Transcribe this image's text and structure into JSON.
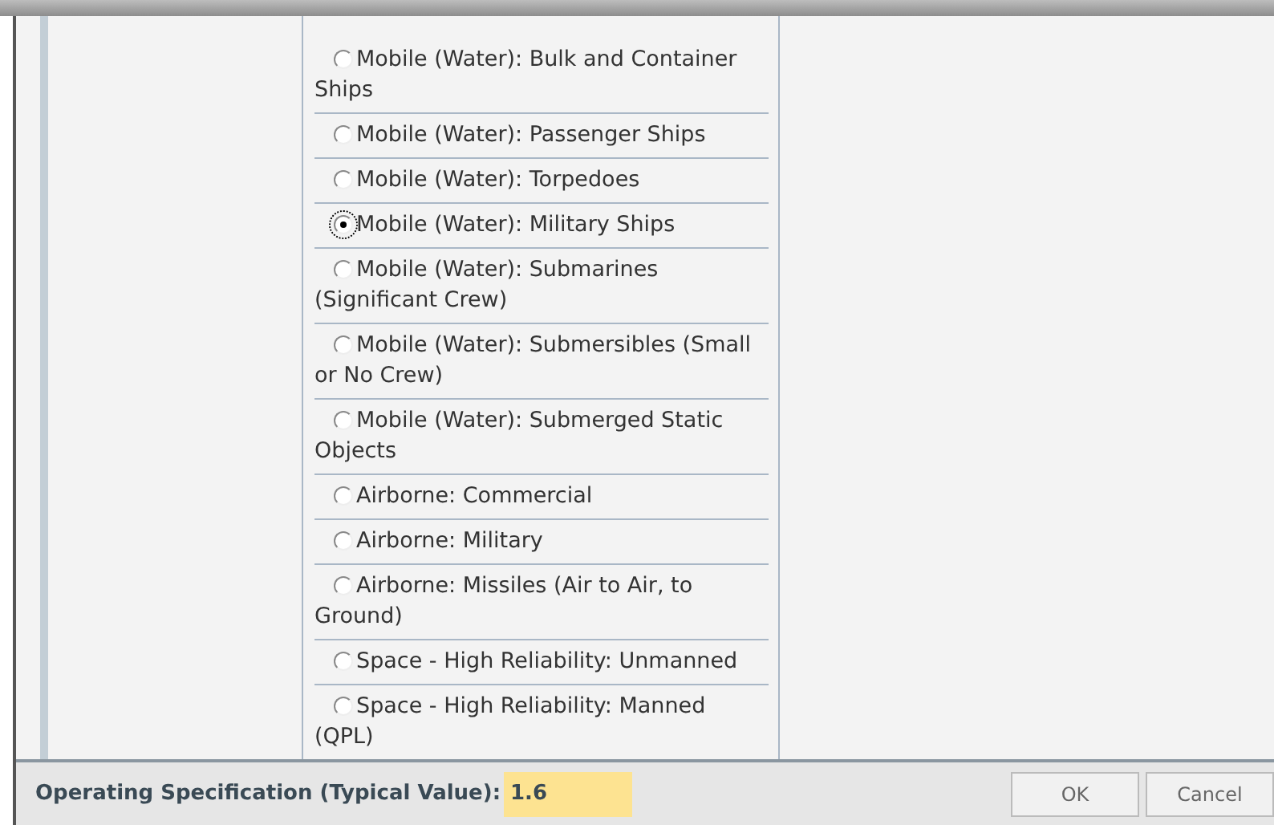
{
  "options": [
    {
      "label": "Mobile (Water): Bulk and Container Ships",
      "selected": false
    },
    {
      "label": "Mobile (Water): Passenger Ships",
      "selected": false
    },
    {
      "label": "Mobile (Water): Torpedoes",
      "selected": false
    },
    {
      "label": "Mobile (Water): Military Ships",
      "selected": true
    },
    {
      "label": "Mobile (Water): Submarines (Significant Crew)",
      "selected": false
    },
    {
      "label": "Mobile (Water): Submersibles (Small or No Crew)",
      "selected": false
    },
    {
      "label": "Mobile (Water): Submerged Static Objects",
      "selected": false
    },
    {
      "label": "Airborne: Commercial",
      "selected": false
    },
    {
      "label": "Airborne: Military",
      "selected": false
    },
    {
      "label": "Airborne: Missiles (Air to Air, to Ground)",
      "selected": false
    },
    {
      "label": "Space - High Reliability: Unmanned",
      "selected": false
    },
    {
      "label": "Space - High Reliability: Manned (QPL)",
      "selected": false
    }
  ],
  "footer": {
    "label": "Operating Specification (Typical Value):",
    "value": "1.6",
    "buttons": [
      "OK",
      "Cancel"
    ]
  }
}
